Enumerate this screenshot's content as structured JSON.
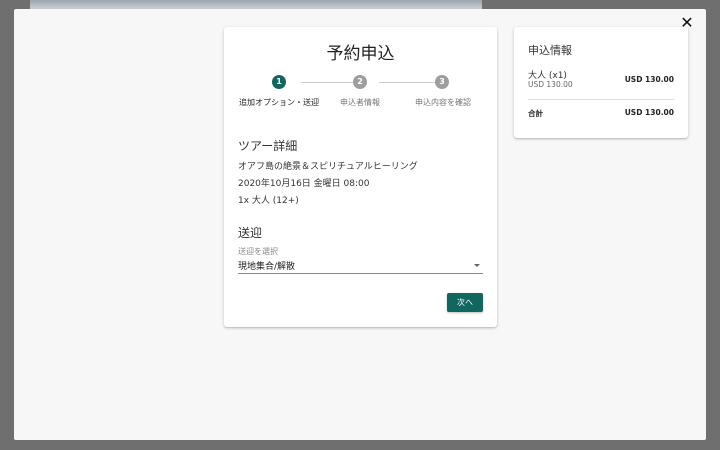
{
  "colors": {
    "accent": "#11665f",
    "step_inactive": "#9e9e9e",
    "step_label_active": "#222222",
    "step_label_inactive": "#777777"
  },
  "modal": {
    "close_label": "✕"
  },
  "booking": {
    "title": "予約申込",
    "steps": [
      {
        "number": "1",
        "label": "追加オプション・送迎",
        "active": true
      },
      {
        "number": "2",
        "label": "申込者情報",
        "active": false
      },
      {
        "number": "3",
        "label": "申込内容を確認",
        "active": false
      }
    ],
    "tour_details": {
      "heading": "ツアー詳細",
      "name": "オアフ島の絶景＆スピリチュアルヒーリング",
      "datetime": "2020年10月16日 金曜日 08:00",
      "participants": "1x 大人 (12+)"
    },
    "transfer": {
      "heading": "送迎",
      "select_label": "送迎を選択",
      "selected_value": "現地集合/解散"
    },
    "next_label": "次へ"
  },
  "summary": {
    "title": "申込情報",
    "item_name": "大人 (x1)",
    "item_unit_price": "USD 130.00",
    "item_price": "USD 130.00",
    "total_label": "合計",
    "total_value": "USD 130.00"
  }
}
